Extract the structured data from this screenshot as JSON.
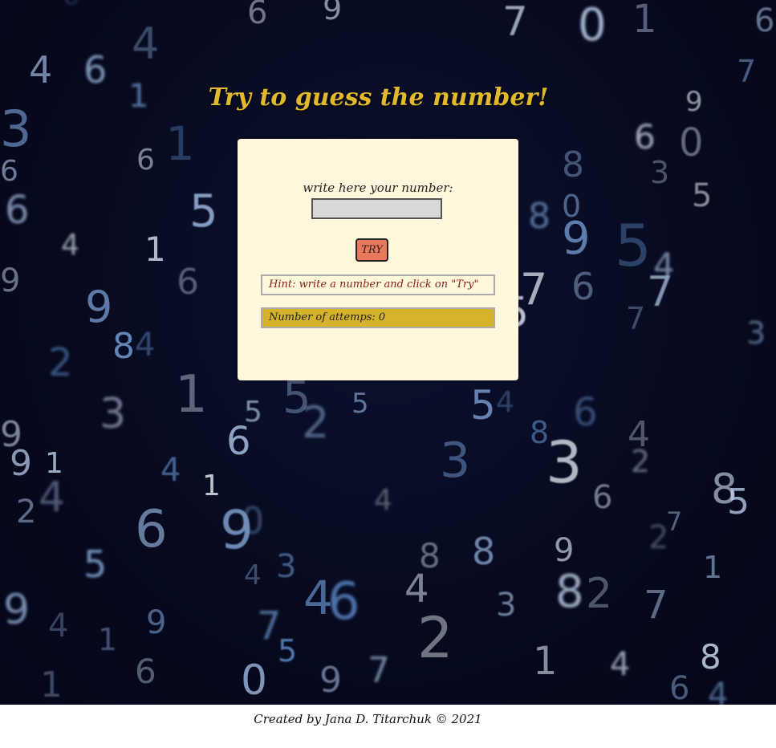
{
  "page": {
    "title": "Try to guess the number!"
  },
  "game": {
    "prompt_label": "write here your number:",
    "input_value": "",
    "try_label": "TRY",
    "hint_text": "Hint: write a number and click on \"Try\"",
    "attempts_text": "Number of attemps: 0"
  },
  "footer": {
    "credit": "Created by Jana D. Titarchuk © 2021"
  },
  "colors": {
    "background": "#070a1e",
    "title": "#e3b92c",
    "panel": "#fff8dc",
    "try_button": "#e8795a",
    "hint_text": "#8a1d14",
    "attempts_bg": "#d6b32a",
    "footer_bg": "#ffffff"
  },
  "background_digits": [
    "8",
    "6",
    "9",
    "7",
    "0",
    "1",
    "6",
    "4",
    "6",
    "4",
    "7",
    "3",
    "1",
    "1",
    "6",
    "9",
    "6",
    "3",
    "0",
    "6",
    "6",
    "5",
    "8",
    "0",
    "8",
    "9",
    "5",
    "5",
    "4",
    "1",
    "6",
    "9",
    "4",
    "7",
    "7",
    "6",
    "3",
    "9",
    "8",
    "4",
    "2",
    "7",
    "5",
    "1",
    "3",
    "5",
    "6",
    "5",
    "2",
    "5",
    "5",
    "4",
    "6",
    "8",
    "3",
    "4",
    "2",
    "9",
    "9",
    "1",
    "4",
    "2",
    "6",
    "9",
    "0",
    "3",
    "4",
    "1",
    "4",
    "6",
    "8",
    "5",
    "2",
    "7",
    "1",
    "8",
    "5",
    "4",
    "3",
    "4",
    "6",
    "8",
    "4",
    "9",
    "8",
    "2",
    "7",
    "3",
    "9",
    "4",
    "1",
    "9",
    "7",
    "5",
    "2",
    "1",
    "4"
  ]
}
